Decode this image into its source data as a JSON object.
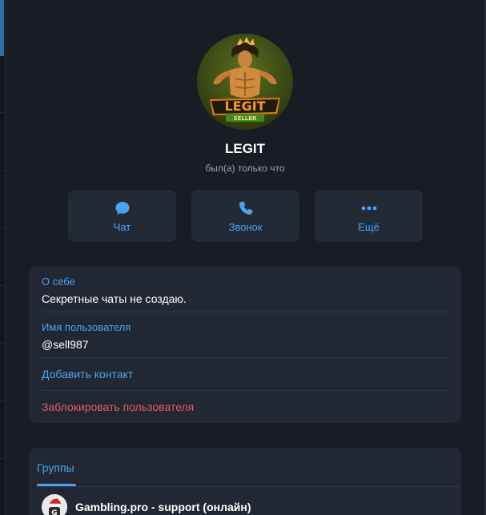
{
  "profile": {
    "name": "LEGIT",
    "status": "был(а) только что",
    "avatar_icon": "legit-seller-logo",
    "avatar_text_top": "LEGIT",
    "avatar_text_bottom": "SELLER"
  },
  "actions": [
    {
      "label": "Чат",
      "icon": "chat-bubble-icon"
    },
    {
      "label": "Звонок",
      "icon": "phone-icon"
    },
    {
      "label": "Ещё",
      "icon": "more-dots-icon"
    }
  ],
  "info": {
    "bio_label": "О себе",
    "bio_value": "Секретные чаты не создаю.",
    "username_label": "Имя пользователя",
    "username_value": "@sell987",
    "add_contact": "Добавить контакт",
    "block_user": "Заблокировать пользователя"
  },
  "groups": {
    "tab_label": "Группы",
    "items": [
      {
        "name": "Gambling.pro - support (онлайн)",
        "avatar_letter": "G"
      }
    ]
  },
  "colors": {
    "accent": "#4aa3ef",
    "danger": "#e8595a",
    "card": "#212833",
    "background": "#181c24"
  }
}
